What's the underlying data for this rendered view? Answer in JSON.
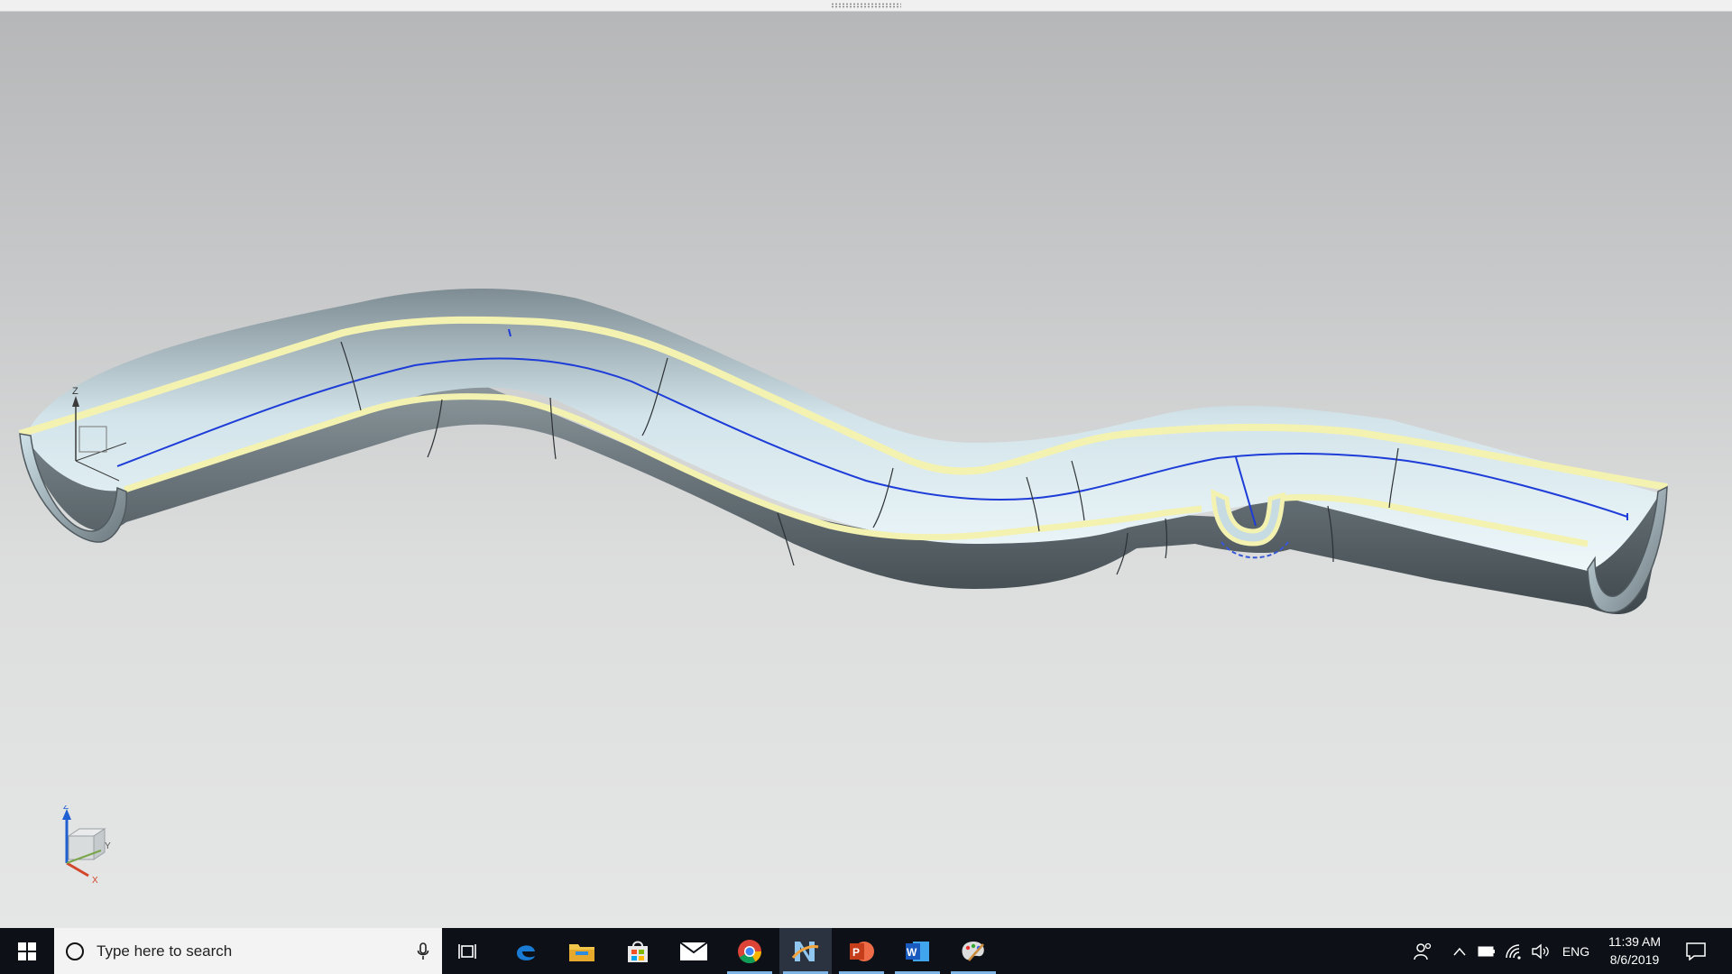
{
  "taskbar": {
    "search_placeholder": "Type here to search",
    "apps": [
      "task-view",
      "edge",
      "file-explorer",
      "store",
      "mail",
      "chrome",
      "nx-cad",
      "powerpoint",
      "word",
      "paint"
    ],
    "tray": {
      "language": "ENG",
      "time": "11:39 AM",
      "date": "8/6/2019"
    }
  },
  "viewport": {
    "triad_axes": {
      "x": "X",
      "y": "Y",
      "z": "Z"
    },
    "wcs_axes": {
      "z": "Z"
    }
  },
  "colors": {
    "background_top": "#b6b7b8",
    "background_bottom": "#e5e6e6",
    "pipe_rim": "#f4f2b0",
    "centerline": "#1d3cd8",
    "taskbar": "#0d1117"
  }
}
